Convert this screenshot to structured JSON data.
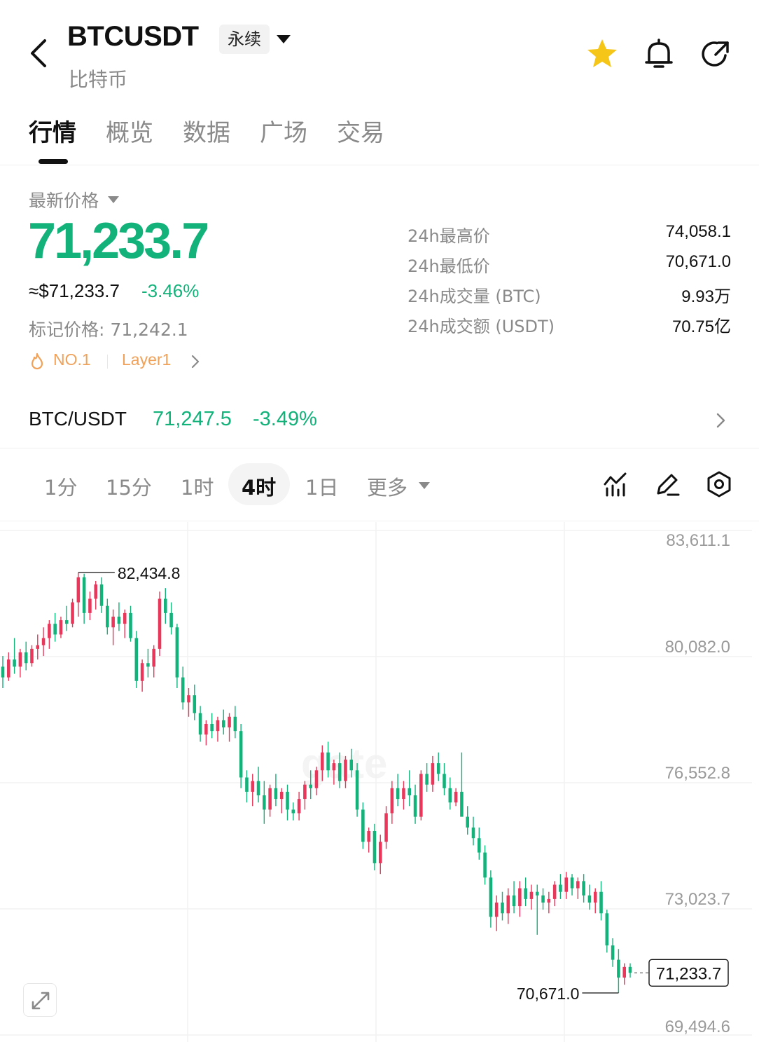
{
  "header": {
    "title": "BTCUSDT",
    "subtitle": "比特币",
    "contract_type": "永续",
    "icons": [
      "back-icon",
      "caret-down-icon",
      "star-icon",
      "bell-icon",
      "share-icon"
    ],
    "favorite_color": "#f5c518"
  },
  "tabs": [
    {
      "label": "行情",
      "active": true
    },
    {
      "label": "概览",
      "active": false
    },
    {
      "label": "数据",
      "active": false
    },
    {
      "label": "广场",
      "active": false
    },
    {
      "label": "交易",
      "active": false
    }
  ],
  "price": {
    "label": "最新价格",
    "last": "71,233.7",
    "usd": "≈$71,233.7",
    "change_pct": "-3.46%",
    "mark": "标记价格: 71,242.1",
    "rank_tag": "NO.1",
    "category_tag": "Layer1",
    "color_down": "#14b27b"
  },
  "stats": [
    {
      "label": "24h最高价",
      "value": "74,058.1"
    },
    {
      "label": "24h最低价",
      "value": "70,671.0"
    },
    {
      "label": "24h成交量 (BTC)",
      "value": "9.93万"
    },
    {
      "label": "24h成交额 (USDT)",
      "value": "70.75亿"
    }
  ],
  "spot_pair": {
    "name": "BTC/USDT",
    "price": "71,247.5",
    "change_pct": "-3.49%"
  },
  "toolbar": {
    "intervals": [
      {
        "label": "1分",
        "active": false
      },
      {
        "label": "15分",
        "active": false
      },
      {
        "label": "1时",
        "active": false
      },
      {
        "label": "4时",
        "active": true
      },
      {
        "label": "1日",
        "active": false
      }
    ],
    "more_label": "更多",
    "tool_icons": [
      "indicator-icon",
      "draw-pencil-icon",
      "settings-hex-icon"
    ]
  },
  "chart_data": {
    "type": "candlestick",
    "interval": "4时",
    "y_ticks": [
      "83,611.1",
      "80,082.0",
      "76,552.8",
      "73,023.7",
      "69,494.6"
    ],
    "y_tick_values": [
      83611.1,
      80082.0,
      76552.8,
      73023.7,
      69494.6
    ],
    "ylim": [
      69494.6,
      83611.1
    ],
    "max_label": "82,434.8",
    "min_label": "70,671.0",
    "last_price_label": "71,233.7",
    "up_color": "#e8375a",
    "down_color": "#14b27b",
    "watermark": "gate",
    "candles": [
      [
        79800,
        80100,
        79200,
        79500
      ],
      [
        79500,
        80200,
        79400,
        80000
      ],
      [
        80000,
        80600,
        79600,
        79800
      ],
      [
        79800,
        80300,
        79500,
        80200
      ],
      [
        80200,
        80500,
        79700,
        79900
      ],
      [
        79900,
        80400,
        79800,
        80300
      ],
      [
        80300,
        80700,
        80000,
        80400
      ],
      [
        80400,
        80900,
        80100,
        80600
      ],
      [
        80600,
        81100,
        80300,
        81000
      ],
      [
        81000,
        81300,
        80500,
        80700
      ],
      [
        80700,
        81200,
        80600,
        81100
      ],
      [
        81100,
        81500,
        80800,
        81000
      ],
      [
        81000,
        81700,
        80900,
        81600
      ],
      [
        81600,
        82434.8,
        81200,
        82300
      ],
      [
        82300,
        82400,
        81000,
        81300
      ],
      [
        81300,
        81900,
        81100,
        81700
      ],
      [
        81700,
        82200,
        81400,
        82100
      ],
      [
        82100,
        82300,
        81300,
        81500
      ],
      [
        81500,
        81700,
        80700,
        80900
      ],
      [
        80900,
        81400,
        80400,
        81200
      ],
      [
        81200,
        81600,
        80800,
        81000
      ],
      [
        81000,
        81400,
        80600,
        81300
      ],
      [
        81300,
        81500,
        80500,
        80600
      ],
      [
        80600,
        80800,
        79200,
        79400
      ],
      [
        79400,
        80000,
        79100,
        79900
      ],
      [
        79900,
        80300,
        79500,
        79800
      ],
      [
        79800,
        80400,
        79500,
        80300
      ],
      [
        80300,
        81900,
        80100,
        81700
      ],
      [
        81700,
        82000,
        81000,
        81300
      ],
      [
        81300,
        81600,
        80700,
        80900
      ],
      [
        80900,
        81000,
        79200,
        79500
      ],
      [
        79500,
        79800,
        78600,
        78800
      ],
      [
        78800,
        79200,
        78400,
        79000
      ],
      [
        79000,
        79300,
        78300,
        78500
      ],
      [
        78500,
        78700,
        77700,
        77900
      ],
      [
        77900,
        78300,
        77600,
        78200
      ],
      [
        78200,
        78500,
        77800,
        78000
      ],
      [
        78000,
        78400,
        77700,
        78300
      ],
      [
        78300,
        78600,
        77900,
        78100
      ],
      [
        78100,
        78500,
        77700,
        78400
      ],
      [
        78400,
        78700,
        77800,
        78000
      ],
      [
        78000,
        78200,
        76400,
        76700
      ],
      [
        76700,
        76900,
        76000,
        76300
      ],
      [
        76300,
        76800,
        75900,
        76600
      ],
      [
        76600,
        77000,
        76000,
        76200
      ],
      [
        76200,
        76600,
        75400,
        75800
      ],
      [
        75800,
        76500,
        75600,
        76400
      ],
      [
        76400,
        76800,
        75900,
        76100
      ],
      [
        76100,
        76400,
        75700,
        76300
      ],
      [
        76300,
        76500,
        75500,
        75800
      ],
      [
        75800,
        76000,
        75500,
        75700
      ],
      [
        75700,
        76300,
        75500,
        76100
      ],
      [
        76100,
        76600,
        75800,
        76500
      ],
      [
        76500,
        76900,
        76100,
        76400
      ],
      [
        76400,
        77000,
        76200,
        76900
      ],
      [
        76900,
        77600,
        76600,
        77400
      ],
      [
        77400,
        77700,
        76700,
        76900
      ],
      [
        76900,
        77200,
        76500,
        77100
      ],
      [
        77100,
        77400,
        76400,
        76600
      ],
      [
        76600,
        77300,
        76400,
        77200
      ],
      [
        77200,
        77500,
        76700,
        76900
      ],
      [
        76900,
        77100,
        75600,
        75800
      ],
      [
        75800,
        76000,
        74700,
        74900
      ],
      [
        74900,
        75300,
        74600,
        75200
      ],
      [
        75200,
        75400,
        74100,
        74300
      ],
      [
        74300,
        75100,
        74000,
        74900
      ],
      [
        74900,
        75900,
        74700,
        75700
      ],
      [
        75700,
        76600,
        75400,
        76400
      ],
      [
        76400,
        76800,
        75900,
        76100
      ],
      [
        76100,
        76600,
        75800,
        76400
      ],
      [
        76400,
        76900,
        75900,
        76200
      ],
      [
        76200,
        76500,
        75400,
        75600
      ],
      [
        75600,
        76900,
        75500,
        76800
      ],
      [
        76800,
        77100,
        76300,
        76500
      ],
      [
        76500,
        77300,
        76300,
        77100
      ],
      [
        77100,
        77400,
        76600,
        76800
      ],
      [
        76800,
        77100,
        76200,
        76400
      ],
      [
        76400,
        76700,
        75800,
        76000
      ],
      [
        76000,
        76400,
        75900,
        76300
      ],
      [
        76300,
        77400,
        76100,
        75600
      ],
      [
        75600,
        75900,
        75100,
        75300
      ],
      [
        75300,
        75600,
        74800,
        75000
      ],
      [
        75000,
        75300,
        74400,
        74600
      ],
      [
        74600,
        74800,
        73700,
        73900
      ],
      [
        73900,
        74100,
        72500,
        72800
      ],
      [
        72800,
        73400,
        72400,
        73200
      ],
      [
        73200,
        73500,
        72700,
        72900
      ],
      [
        72900,
        73600,
        72600,
        73400
      ],
      [
        73400,
        73800,
        72900,
        73100
      ],
      [
        73100,
        73800,
        72800,
        73600
      ],
      [
        73600,
        73900,
        73100,
        73300
      ],
      [
        73300,
        73700,
        73000,
        73500
      ],
      [
        73500,
        73700,
        72300,
        73400
      ],
      [
        73400,
        73600,
        73000,
        73200
      ],
      [
        73200,
        73500,
        72900,
        73300
      ],
      [
        73300,
        73800,
        73100,
        73700
      ],
      [
        73700,
        74000,
        73300,
        73500
      ],
      [
        73500,
        74058.1,
        73300,
        73900
      ],
      [
        73900,
        74000,
        73400,
        73600
      ],
      [
        73600,
        73900,
        73300,
        73800
      ],
      [
        73800,
        74000,
        73200,
        73400
      ],
      [
        73400,
        73700,
        73000,
        73200
      ],
      [
        73200,
        73600,
        72900,
        73500
      ],
      [
        73500,
        73800,
        72700,
        72900
      ],
      [
        72900,
        73000,
        71800,
        72000
      ],
      [
        72000,
        72200,
        71400,
        71600
      ],
      [
        71600,
        71900,
        70671.0,
        71100
      ],
      [
        71100,
        71500,
        70900,
        71400
      ],
      [
        71400,
        71500,
        71100,
        71233.7
      ]
    ]
  }
}
